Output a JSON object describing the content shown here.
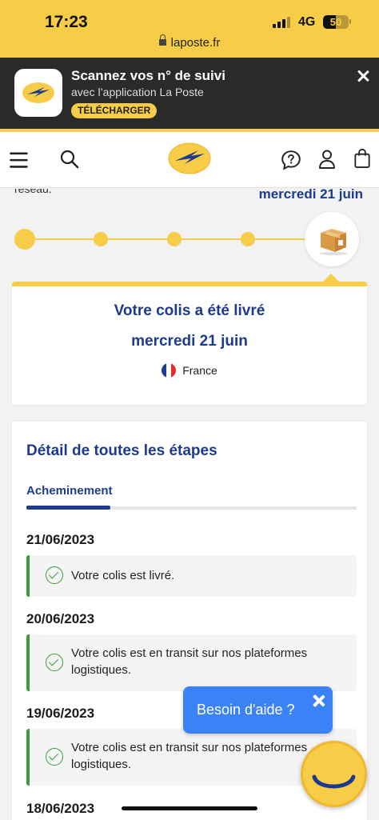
{
  "status_bar": {
    "time": "17:23",
    "url": "laposte.fr",
    "network": "4G",
    "battery": "50",
    "battery_level": 0.5,
    "accent_color": "#f7cc47"
  },
  "app_banner": {
    "title": "Scannez vos n° de suivi",
    "subtitle": "avec l’application La Poste",
    "download_label": "TÉLÉCHARGER",
    "close_icon": "close-icon"
  },
  "navbar": {
    "icons": [
      "menu-icon",
      "search-icon",
      "laposte-logo",
      "help-icon",
      "user-icon",
      "bag-icon"
    ]
  },
  "tracking": {
    "cut_text": "réseau.",
    "header_date": "mercredi 21 juin",
    "progress_step": 5,
    "progress_total": 5,
    "status_title": "Votre colis a été livré",
    "status_date": "mercredi 21 juin",
    "country": "France",
    "brand_color": "#1c3b8c",
    "success_color": "#3a9d3a"
  },
  "details": {
    "title": "Détail de toutes les étapes",
    "tab": "Acheminement",
    "steps": [
      {
        "date": "21/06/2023",
        "event": "Votre colis est livré."
      },
      {
        "date": "20/06/2023",
        "event": "Votre colis est en transit sur nos plateformes logistiques."
      },
      {
        "date": "19/06/2023",
        "event": "Votre colis est en transit sur nos plateformes logistiques."
      },
      {
        "date": "18/06/2023"
      }
    ]
  },
  "help": {
    "label": "Besoin d'aide ?",
    "close_icon": "close-icon",
    "chat_icon": "smile-chat-icon"
  }
}
